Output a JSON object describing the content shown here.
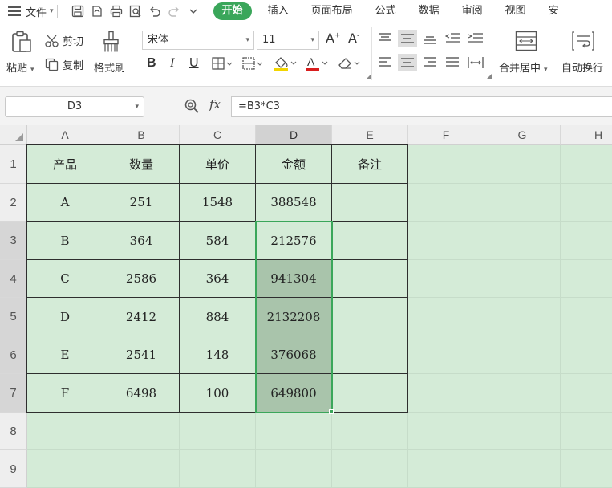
{
  "menu": {
    "file_label": "文件",
    "tabs": [
      "开始",
      "插入",
      "页面布局",
      "公式",
      "数据",
      "审阅",
      "视图",
      "安"
    ]
  },
  "ribbon": {
    "paste_label": "粘贴",
    "cut_label": "剪切",
    "copy_label": "复制",
    "format_painter_label": "格式刷",
    "font_name": "宋体",
    "font_size": "11",
    "merge_center_label": "合并居中",
    "wrap_text_label": "自动换行"
  },
  "formula_bar": {
    "name_box": "D3",
    "fx_label": "fx",
    "formula": "=B3*C3"
  },
  "sheet": {
    "columns": [
      "A",
      "B",
      "C",
      "D",
      "E",
      "F",
      "G",
      "H"
    ],
    "rows": [
      "1",
      "2",
      "3",
      "4",
      "5",
      "6",
      "7",
      "8",
      "9"
    ],
    "header_row": [
      "产品",
      "数量",
      "单价",
      "金额",
      "备注"
    ],
    "data_rows": [
      [
        "A",
        "251",
        "1548",
        "388548",
        ""
      ],
      [
        "B",
        "364",
        "584",
        "212576",
        ""
      ],
      [
        "C",
        "2586",
        "364",
        "941304",
        ""
      ],
      [
        "D",
        "2412",
        "884",
        "2132208",
        ""
      ],
      [
        "E",
        "2541",
        "148",
        "376068",
        ""
      ],
      [
        "F",
        "6498",
        "100",
        "649800",
        ""
      ]
    ]
  },
  "colors": {
    "accent": "#3aa65a",
    "sheet_background": "#d4ebd7",
    "selection_fill": "#a9c4ab"
  }
}
